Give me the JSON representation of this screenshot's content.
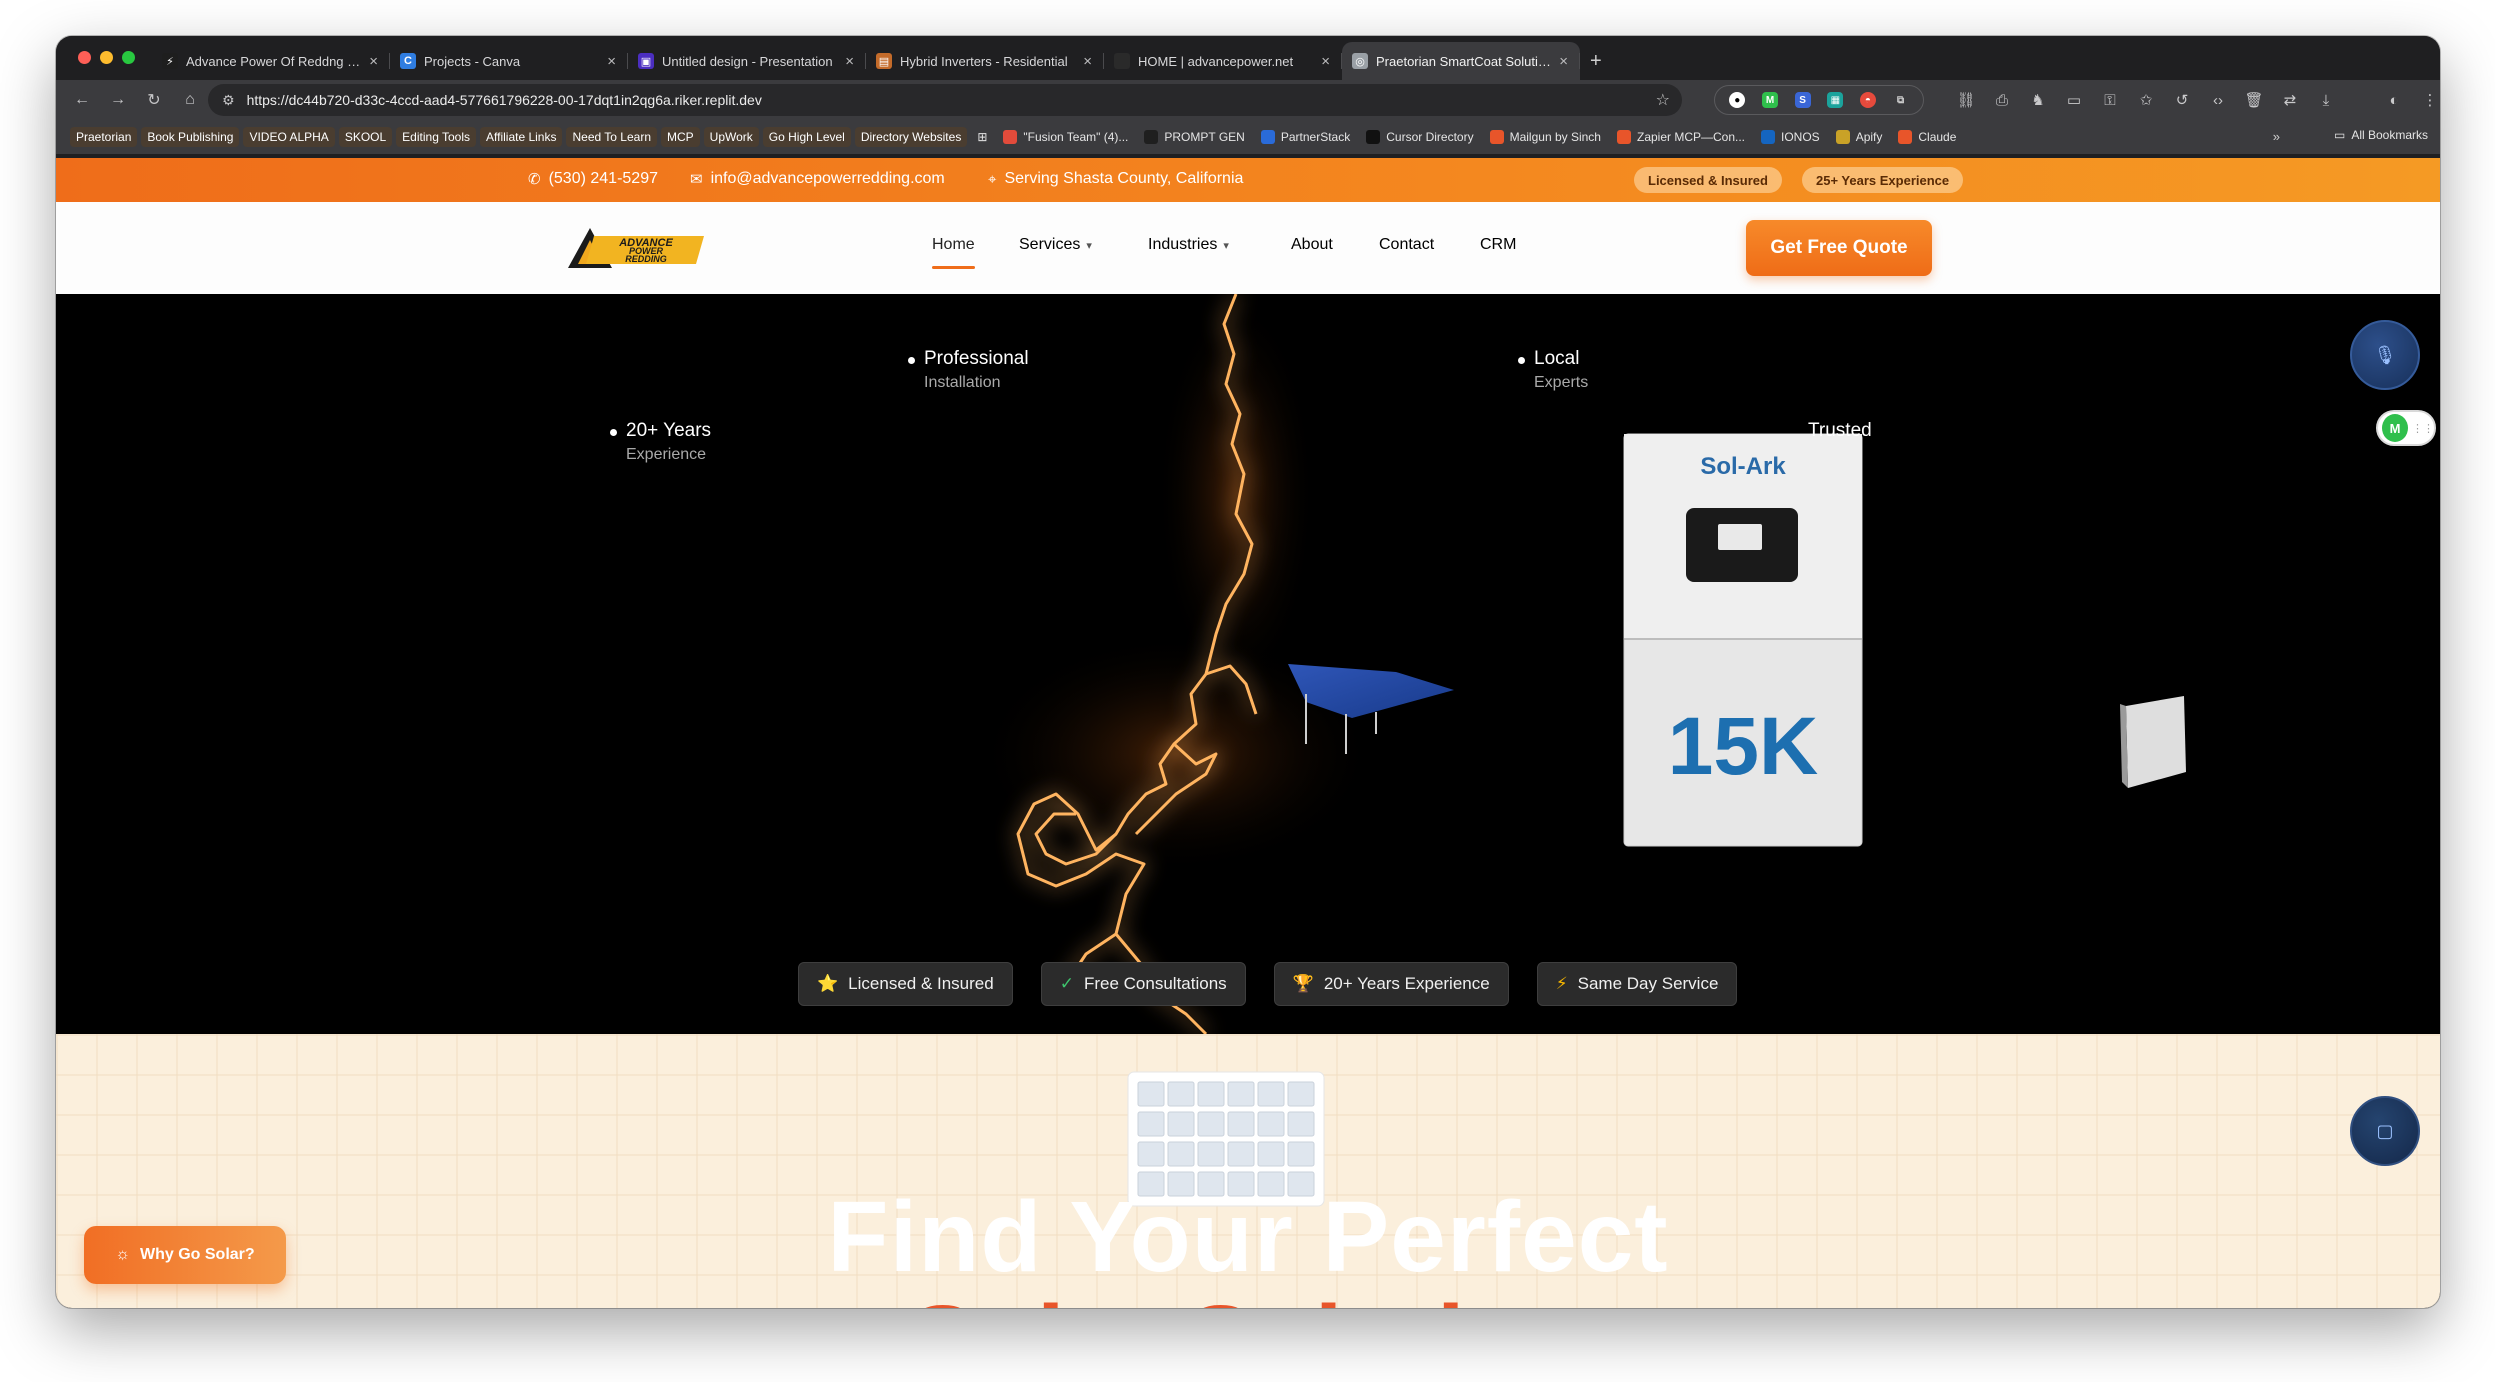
{
  "browser": {
    "tabs": [
      {
        "title": "Advance Power Of Reddng | F",
        "color": "#1e1e1e",
        "glyph": "⚡"
      },
      {
        "title": "Projects - Canva",
        "color": "#2f7de1",
        "glyph": "C"
      },
      {
        "title": "Untitled design - Presentation",
        "color": "#4b2ec0",
        "glyph": "▣"
      },
      {
        "title": "Hybrid Inverters - Residential",
        "color": "#c46b2a",
        "glyph": "▤"
      },
      {
        "title": "HOME | advancepower.net",
        "color": "#2a2a2a",
        "glyph": ""
      },
      {
        "title": "Praetorian SmartCoat Solution",
        "color": "#9aa0a6",
        "glyph": "◎"
      }
    ],
    "url": "https://dc44b720-d33c-4ccd-aad4-577661796228-00-17dqt1in2qg6a.riker.replit.dev",
    "bookmarks": [
      {
        "label": "Praetorian",
        "highlight": true
      },
      {
        "label": "Book Publishing",
        "highlight": true
      },
      {
        "label": "VIDEO ALPHA",
        "highlight": true
      },
      {
        "label": "SKOOL",
        "highlight": true
      },
      {
        "label": "Editing Tools",
        "highlight": true
      },
      {
        "label": "Affiliate Links",
        "highlight": true
      },
      {
        "label": "Need To Learn",
        "highlight": true
      },
      {
        "label": "MCP",
        "highlight": true
      },
      {
        "label": "UpWork",
        "highlight": true
      },
      {
        "label": "Go High Level",
        "highlight": true
      },
      {
        "label": "Directory Websites",
        "highlight": true
      },
      {
        "label": "\"Fusion Team\" (4)...",
        "highlight": false
      },
      {
        "label": "PROMPT GEN",
        "highlight": false
      },
      {
        "label": "PartnerStack",
        "highlight": false
      },
      {
        "label": "Cursor Directory",
        "highlight": false
      },
      {
        "label": "Mailgun by Sinch",
        "highlight": false
      },
      {
        "label": "Zapier MCP—Con...",
        "highlight": false
      },
      {
        "label": "IONOS",
        "highlight": false
      },
      {
        "label": "Apify",
        "highlight": false
      },
      {
        "label": "Claude",
        "highlight": false
      }
    ],
    "all_bookmarks": "All Bookmarks"
  },
  "site": {
    "topbar": {
      "phone": "(530) 241-5297",
      "email": "info@advancepowerredding.com",
      "location": "Serving Shasta County, California",
      "pill_1": "Licensed & Insured",
      "pill_2": "25+ Years Experience"
    },
    "logo_text": "ADVANCE POWER REDDING",
    "nav": {
      "home": "Home",
      "services": "Services",
      "industries": "Industries",
      "about": "About",
      "contact": "Contact",
      "crm": "CRM",
      "cta": "Get Free Quote"
    },
    "hero": {
      "feature_professional": "Professional",
      "feature_professional_sub": "Installation",
      "feature_local": "Local",
      "feature_local_sub": "Experts",
      "feature_years": "20+ Years",
      "feature_years_sub": "Experience",
      "feature_trusted": "Trusted",
      "inverter_brand": "Sol-Ark",
      "inverter_model": "15K",
      "badges": [
        {
          "icon": "⭐",
          "label": "Licensed & Insured"
        },
        {
          "icon": "✓",
          "label": "Free Consultations"
        },
        {
          "icon": "🏆",
          "label": "20+ Years Experience"
        },
        {
          "icon": "⚡",
          "label": "Same Day Service"
        }
      ]
    },
    "section": {
      "headline": "Find Your Perfect",
      "headline_2": "Solar Solution",
      "why_button": "Why Go Solar?"
    }
  },
  "colors": {
    "accent": "#ef6d1a",
    "hero_bg": "#000000",
    "lower_bg": "#fbefdc"
  }
}
